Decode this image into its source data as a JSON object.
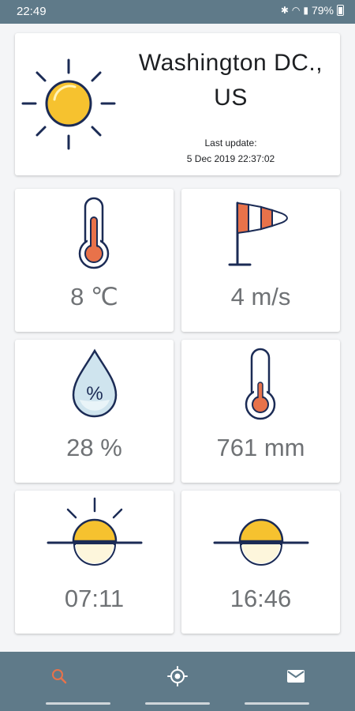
{
  "status_bar": {
    "time": "22:49",
    "battery": "79%",
    "icons": [
      "bluetooth-icon",
      "wifi-icon",
      "volte-icon",
      "signal-icon",
      "battery-icon"
    ]
  },
  "location": {
    "city": "Washington DC., US",
    "update_label": "Last update:",
    "update_time": "5 Dec 2019 22:37:02"
  },
  "tiles": {
    "temperature": "8 ℃",
    "wind": "4 m/s",
    "humidity": "28 %",
    "pressure": "761 mm",
    "sunrise": "07:11",
    "sunset": "16:46"
  },
  "bottom_nav": {
    "items": [
      "search-icon",
      "location-icon",
      "mail-icon"
    ],
    "active": "search-icon"
  },
  "colors": {
    "bar": "#5f7a89",
    "accent": "#e8724a",
    "sun": "#f6c22f",
    "navy": "#1b2b55",
    "text": "#6f7275"
  }
}
